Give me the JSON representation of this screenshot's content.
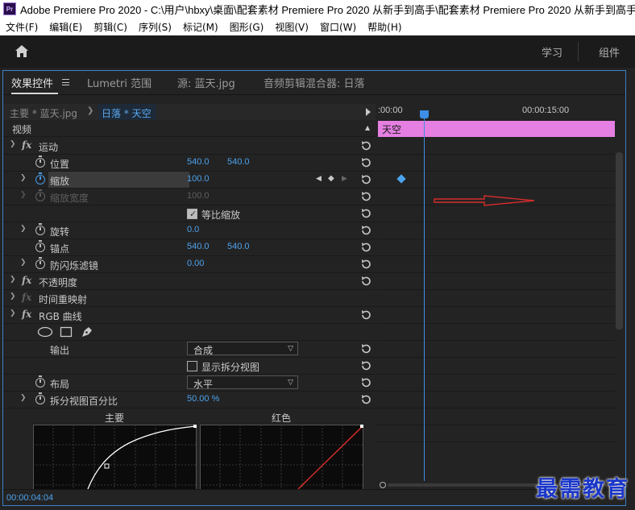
{
  "window": {
    "title": "Adobe Premiere Pro 2020 - C:\\用户\\hbxy\\桌面\\配套素材 Premiere Pro 2020 从新手到高手\\配套素材 Premiere Pro 2020 从新手到高手\\第",
    "app_icon_label": "Pr"
  },
  "menu": [
    "文件(F)",
    "编辑(E)",
    "剪辑(C)",
    "序列(S)",
    "标记(M)",
    "图形(G)",
    "视图(V)",
    "窗口(W)",
    "帮助(H)"
  ],
  "workspace": {
    "home_icon": "home-icon",
    "tabs": [
      "学习",
      "组件"
    ]
  },
  "panel_tabs": {
    "effect_controls": "效果控件",
    "lumetri": "Lumetri 范围",
    "source": "源: 蓝天.jpg",
    "audio_mixer": "音频剪辑混合器: 日落"
  },
  "clip_header": {
    "master": "主要 * 蓝天.jpg",
    "sequence": "日落 * 天空"
  },
  "effects": {
    "video_label": "视频",
    "motion": {
      "name": "运动",
      "position": {
        "label": "位置",
        "x": "540.0",
        "y": "540.0"
      },
      "scale": {
        "label": "缩放",
        "value": "100.0"
      },
      "scale_width": {
        "label": "缩放宽度",
        "value": "100.0"
      },
      "uniform_scale": {
        "label": "等比缩放",
        "checked": true
      },
      "rotation": {
        "label": "旋转",
        "value": "0.0"
      },
      "anchor": {
        "label": "锚点",
        "x": "540.0",
        "y": "540.0"
      },
      "anti_flicker": {
        "label": "防闪烁滤镜",
        "value": "0.00"
      }
    },
    "opacity": {
      "name": "不透明度"
    },
    "time_remap": {
      "name": "时间重映射"
    },
    "rgb_curves": {
      "name": "RGB 曲线",
      "output": {
        "label": "输出",
        "value": "合成"
      },
      "show_split": {
        "label": "显示拆分视图",
        "checked": false
      },
      "layout": {
        "label": "布局",
        "value": "水平"
      },
      "split_percent": {
        "label": "拆分视图百分比",
        "value": "50.00 %"
      },
      "curve_master": "主要",
      "curve_red": "红色"
    }
  },
  "timeline": {
    "start_label": ":00:00",
    "mid_label": "00:00:15:00",
    "clip_name": "天空",
    "playhead_color": "#3d8ee6",
    "clip_color": "#e57fe1"
  },
  "footer": {
    "timecode": "00:00:04:04"
  },
  "watermark": "最需教育"
}
